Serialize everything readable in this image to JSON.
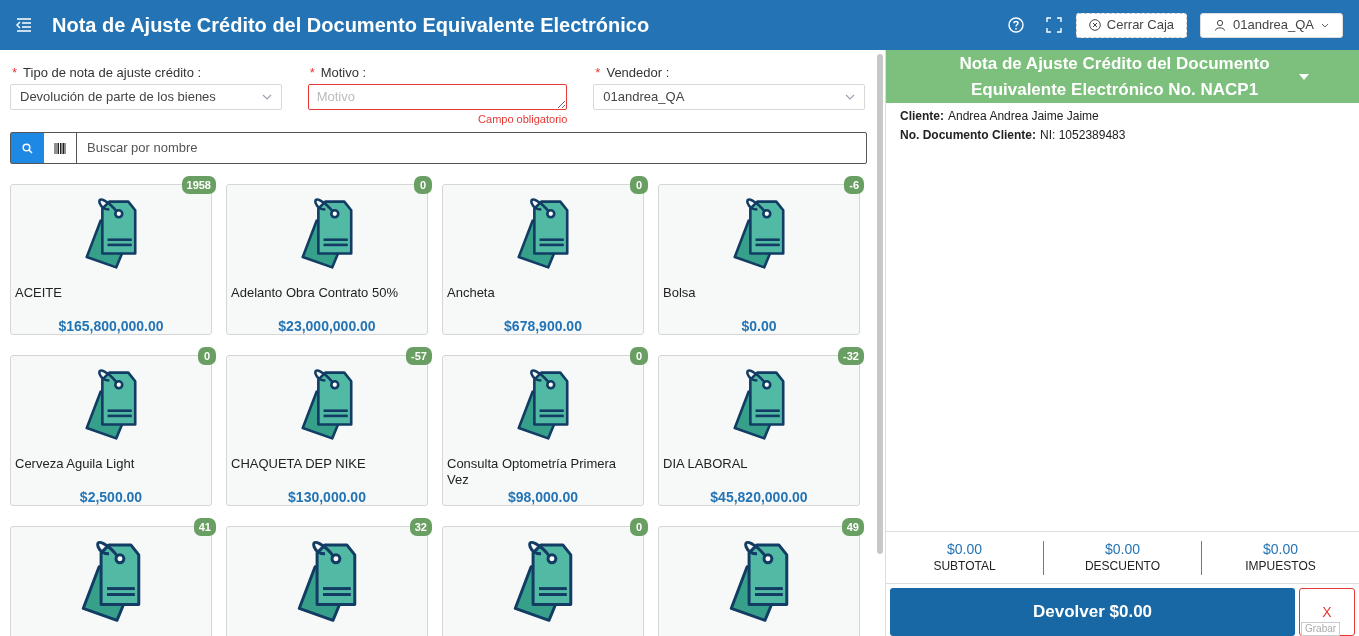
{
  "header": {
    "title": "Nota de Ajuste Crédito del Documento Equivalente Electrónico",
    "close_register": "Cerrar Caja",
    "user": "01andrea_QA"
  },
  "form": {
    "fields": [
      {
        "kind": "select",
        "label": "Tipo de nota de ajuste crédito :",
        "required_mark": "*",
        "value": "Devolución de parte de los bienes"
      },
      {
        "kind": "textarea",
        "label": "Motivo :",
        "required_mark": "*",
        "placeholder": "Motivo",
        "error": "Campo obligatorio"
      },
      {
        "kind": "select",
        "label": "Vendedor :",
        "required_mark": "*",
        "value": "01andrea_QA"
      }
    ]
  },
  "search": {
    "placeholder": "Buscar por nombre"
  },
  "products": [
    {
      "stock": "1958",
      "name": "ACEITE",
      "price": "$165,800,000.00"
    },
    {
      "stock": "0",
      "name": "Adelanto Obra Contrato 50%",
      "price": "$23,000,000.00"
    },
    {
      "stock": "0",
      "name": "Ancheta",
      "price": "$678,900.00"
    },
    {
      "stock": "-6",
      "name": "Bolsa",
      "price": "$0.00"
    },
    {
      "stock": "0",
      "name": "Cerveza Aguila Light",
      "price": "$2,500.00"
    },
    {
      "stock": "-57",
      "name": "CHAQUETA DEP NIKE",
      "price": "$130,000.00"
    },
    {
      "stock": "0",
      "name": "Consulta Optometría Primera Vez",
      "price": "$98,000.00"
    },
    {
      "stock": "-32",
      "name": "DIA LABORAL",
      "price": "$45,820,000.00"
    },
    {
      "stock": "41"
    },
    {
      "stock": "32"
    },
    {
      "stock": "0"
    },
    {
      "stock": "49"
    }
  ],
  "document": {
    "title": "Nota de Ajuste Crédito del Documento Equivalente Electrónico No. NACP1",
    "details": [
      {
        "label": "Cliente:",
        "value": "Andrea Andrea Jaime Jaime"
      },
      {
        "label": "No. Documento Cliente:",
        "value": "NI: 1052389483"
      }
    ],
    "totals": [
      {
        "value": "$0.00",
        "label": "SUBTOTAL"
      },
      {
        "value": "$0.00",
        "label": "DESCUENTO"
      },
      {
        "value": "$0.00",
        "label": "IMPUESTOS"
      }
    ],
    "return_button": "Devolver $0.00",
    "cancel_button": "X",
    "tooltip": "Grabar"
  }
}
